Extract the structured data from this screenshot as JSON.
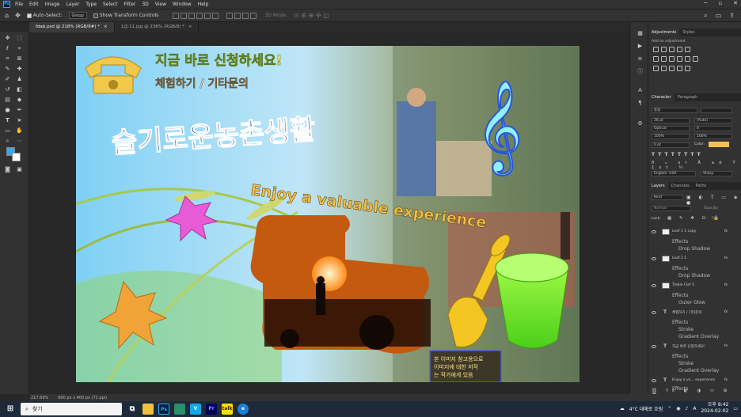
{
  "menubar": {
    "items": [
      "File",
      "Edit",
      "Image",
      "Layer",
      "Type",
      "Select",
      "Filter",
      "3D",
      "View",
      "Window",
      "Help"
    ]
  },
  "options": {
    "auto_select_label": "Auto-Select:",
    "auto_select_value": "Group",
    "transform_label": "Show Transform Controls",
    "mode_3d": "3D Mode:"
  },
  "tabs": [
    {
      "label": "fdab.psd @ 218% (RGB/8#) *",
      "active": true
    },
    {
      "label": "1급-11.jpg @ 236% (RGB/8) *",
      "active": false
    }
  ],
  "artwork": {
    "headline": "지금 바로 신청하세요!",
    "subline": "체험하기 / 기타문의",
    "title_kr": "슬기로운농촌생활",
    "title_en": "Enjoy a valuable experience",
    "box_lines": [
      "본 이미지 참고용으로",
      "이미지에 대한 저작",
      "는 작가에게 있음"
    ]
  },
  "adjustments": {
    "tabs": [
      "Adjustments",
      "Styles"
    ],
    "hint": "Add an adjustment"
  },
  "character": {
    "tabs": [
      "Character",
      "Paragraph"
    ],
    "font": "돋움",
    "size": "36 pt",
    "leading": "(Auto)",
    "kerning": "Optical",
    "tracking": "0",
    "vscale": "100%",
    "hscale": "100%",
    "baseline": "0 pt",
    "color_label": "Color:",
    "lang": "English: USA",
    "aa": "Sharp"
  },
  "layers_panel": {
    "tabs": [
      "Layers",
      "Channels",
      "Paths"
    ],
    "kind": "Kind",
    "blend": "Normal",
    "opacity_label": "Opacity:",
    "lock_label": "Lock:",
    "fill_label": "Fill:",
    "layers": [
      {
        "name": "Leaf 1 1 copy",
        "type": "image",
        "fx": true,
        "effects": [
          "Drop Shadow"
        ]
      },
      {
        "name": "Leaf 1 1",
        "type": "image",
        "fx": true,
        "effects": [
          "Drop Shadow"
        ]
      },
      {
        "name": "Treble Clef 1",
        "type": "image",
        "fx": true,
        "effects": [
          "Outer Glow"
        ]
      },
      {
        "name": "체험하기 / 기타문의",
        "type": "text",
        "fx": true,
        "effects": [
          "Stroke",
          "Gradient Overlay"
        ]
      },
      {
        "name": "지금 바로 신청하세요!",
        "type": "text",
        "fx": true,
        "effects": [
          "Stroke",
          "Gradient Overlay"
        ]
      },
      {
        "name": "Enjoy a va... experience",
        "type": "text",
        "fx": true,
        "effects": []
      }
    ],
    "effects_label": "Effects"
  },
  "status": {
    "zoom": "217.69%",
    "doc": "600 px x 400 px (72 ppi)"
  },
  "taskbar": {
    "search": "찾기",
    "weather": "4°C 대체로 흐림",
    "lang": "A",
    "time": "오후 8:42",
    "date": "2024-02-02"
  },
  "colors": {
    "accent": "#31a8ff",
    "fg": "#31a8ff",
    "bg": "#ffffff",
    "text_color": "#f6c14e"
  }
}
